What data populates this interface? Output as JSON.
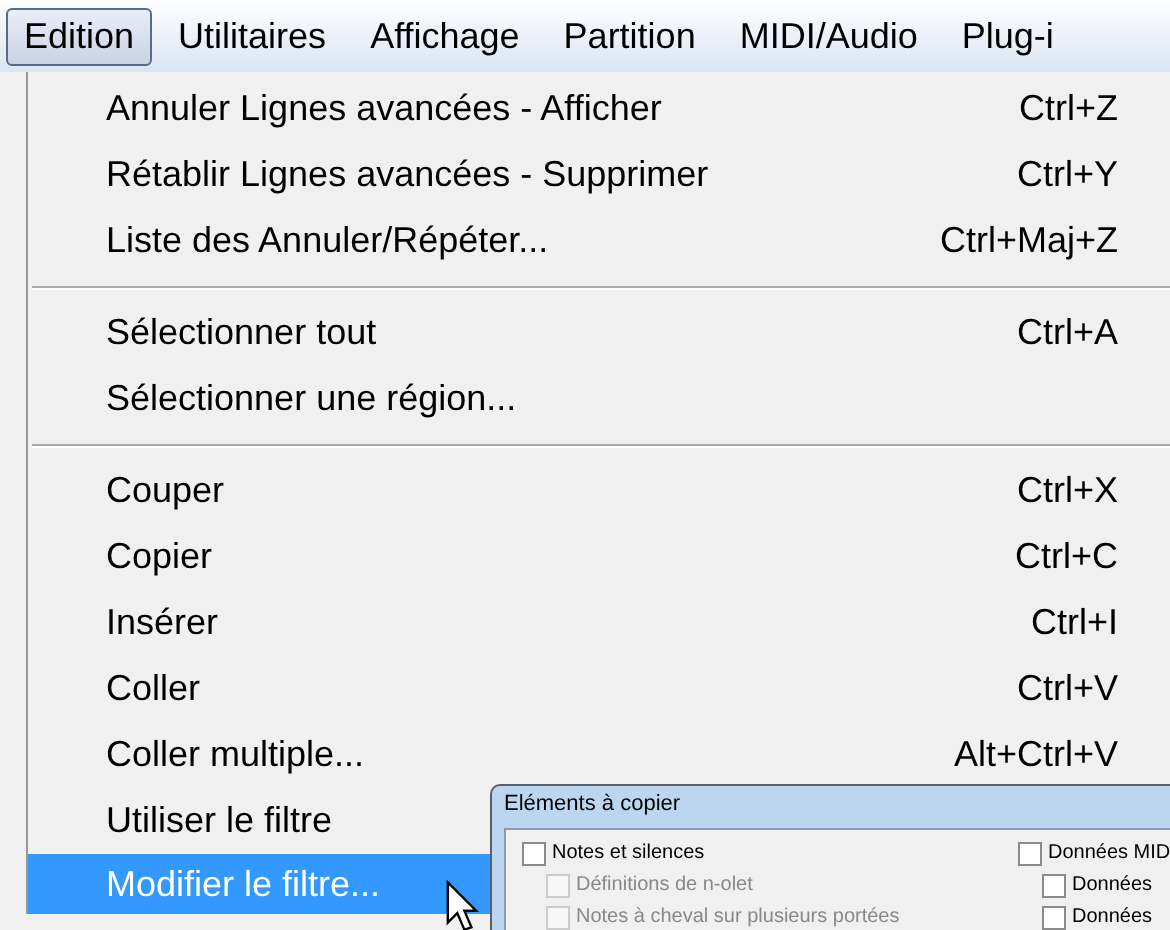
{
  "menu_bar": [
    {
      "label": "Edition",
      "selected": true
    },
    {
      "label": "Utilitaires",
      "selected": false
    },
    {
      "label": "Affichage",
      "selected": false
    },
    {
      "label": "Partition",
      "selected": false
    },
    {
      "label": "MIDI/Audio",
      "selected": false
    },
    {
      "label": "Plug-i",
      "selected": false
    }
  ],
  "menu": [
    {
      "kind": "item",
      "label": "Annuler Lignes avancées - Afficher",
      "shortcut": "Ctrl+Z",
      "selected": false
    },
    {
      "kind": "item",
      "label": "Rétablir Lignes avancées - Supprimer",
      "shortcut": "Ctrl+Y",
      "selected": false
    },
    {
      "kind": "item",
      "label": "Liste des Annuler/Répéter...",
      "shortcut": "Ctrl+Maj+Z",
      "selected": false
    },
    {
      "kind": "separator"
    },
    {
      "kind": "item",
      "label": "Sélectionner tout",
      "shortcut": "Ctrl+A",
      "selected": false
    },
    {
      "kind": "item",
      "label": "Sélectionner une région...",
      "selected": false
    },
    {
      "kind": "separator"
    },
    {
      "kind": "item",
      "label": "Couper",
      "shortcut": "Ctrl+X",
      "selected": false
    },
    {
      "kind": "item",
      "label": "Copier",
      "shortcut": "Ctrl+C",
      "selected": false
    },
    {
      "kind": "item",
      "label": "Insérer",
      "shortcut": "Ctrl+I",
      "selected": false
    },
    {
      "kind": "item",
      "label": "Coller",
      "shortcut": "Ctrl+V",
      "selected": false
    },
    {
      "kind": "item",
      "label": "Coller multiple...",
      "shortcut": "Alt+Ctrl+V",
      "selected": false
    },
    {
      "kind": "item",
      "label": "Utiliser le filtre",
      "selected": false
    },
    {
      "kind": "item",
      "label": "Modifier le filtre...",
      "selected": true
    }
  ],
  "dialog": {
    "title": "Eléments à copier",
    "left_options": [
      {
        "label": "Notes et silences",
        "checked": false,
        "disabled": false,
        "indented": false
      },
      {
        "label": "Définitions de n-olet",
        "checked": false,
        "disabled": true,
        "indented": true
      },
      {
        "label": "Notes à cheval sur plusieurs portées",
        "checked": false,
        "disabled": true,
        "indented": true
      }
    ],
    "right_options": [
      {
        "label": "Données MID",
        "checked": false,
        "disabled": false,
        "indented": false
      },
      {
        "label": "Données",
        "checked": false,
        "disabled": false,
        "indented": true
      },
      {
        "label": "Données",
        "checked": false,
        "disabled": false,
        "indented": true
      }
    ]
  }
}
